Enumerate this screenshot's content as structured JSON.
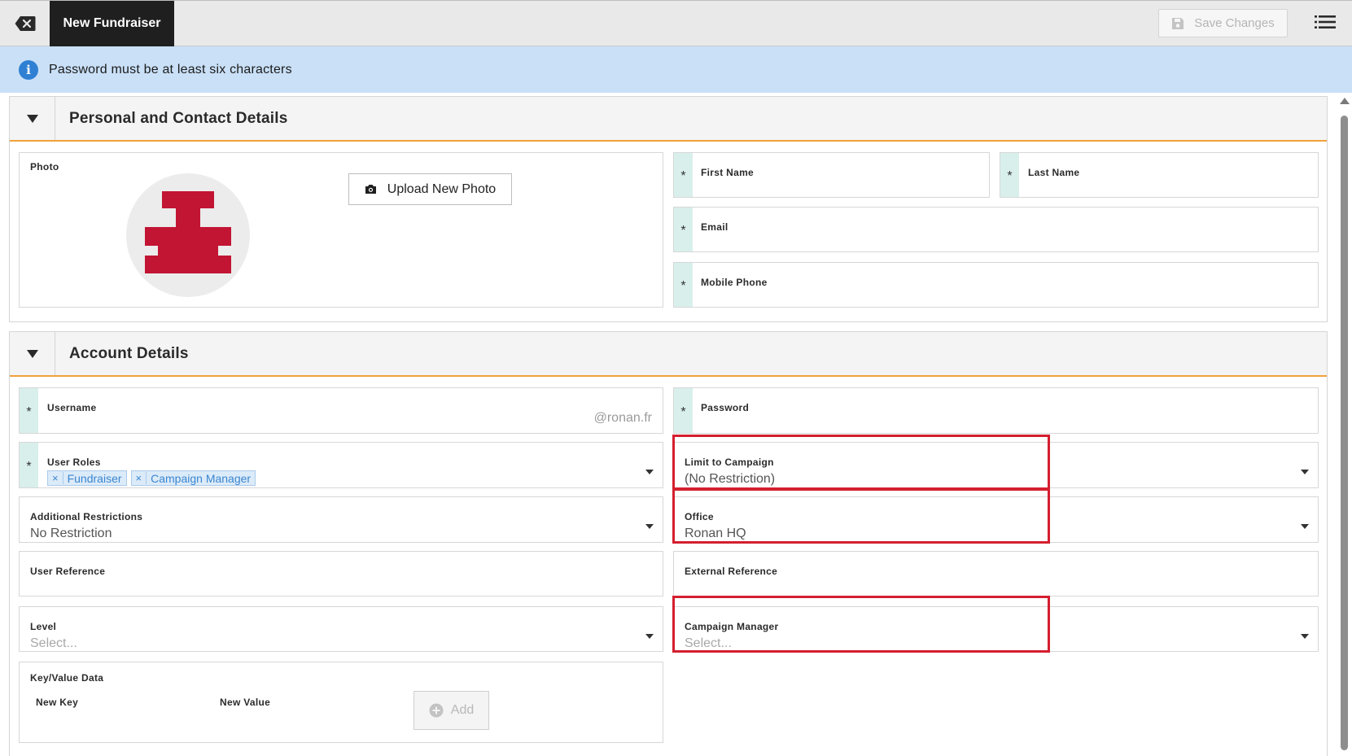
{
  "topbar": {
    "close_icon": "close-x-icon",
    "tab_label": "New Fundraiser",
    "save_label": "Save Changes",
    "menu_icon": "list-menu-icon"
  },
  "info": {
    "icon": "info-icon",
    "message": "Password must be at least six characters"
  },
  "personal": {
    "title": "Personal and Contact Details",
    "photo_label": "Photo",
    "upload_label": "Upload New Photo",
    "first_name_label": "First Name",
    "last_name_label": "Last Name",
    "email_label": "Email",
    "mobile_label": "Mobile Phone",
    "required_mark": "*"
  },
  "account": {
    "title": "Account Details",
    "username_label": "Username",
    "username_suffix": "@ronan.fr",
    "password_label": "Password",
    "roles_label": "User Roles",
    "roles": [
      {
        "remove": "×",
        "label": "Fundraiser"
      },
      {
        "remove": "×",
        "label": "Campaign Manager"
      }
    ],
    "limit_campaign_label": "Limit to Campaign",
    "limit_campaign_value": "(No Restriction)",
    "additional_label": "Additional Restrictions",
    "additional_value": "No Restriction",
    "office_label": "Office",
    "office_value": "Ronan HQ",
    "user_ref_label": "User Reference",
    "external_ref_label": "External Reference",
    "level_label": "Level",
    "level_placeholder": "Select...",
    "campaign_manager_label": "Campaign Manager",
    "campaign_manager_placeholder": "Select...",
    "kv_label": "Key/Value Data",
    "new_key_label": "New Key",
    "new_value_label": "New Value",
    "add_label": "Add"
  },
  "colors": {
    "accent_orange": "#f0a23a",
    "highlight_red": "#d41f2f",
    "info_bg": "#c9e0f7",
    "tag_blue": "#3a86d0"
  }
}
